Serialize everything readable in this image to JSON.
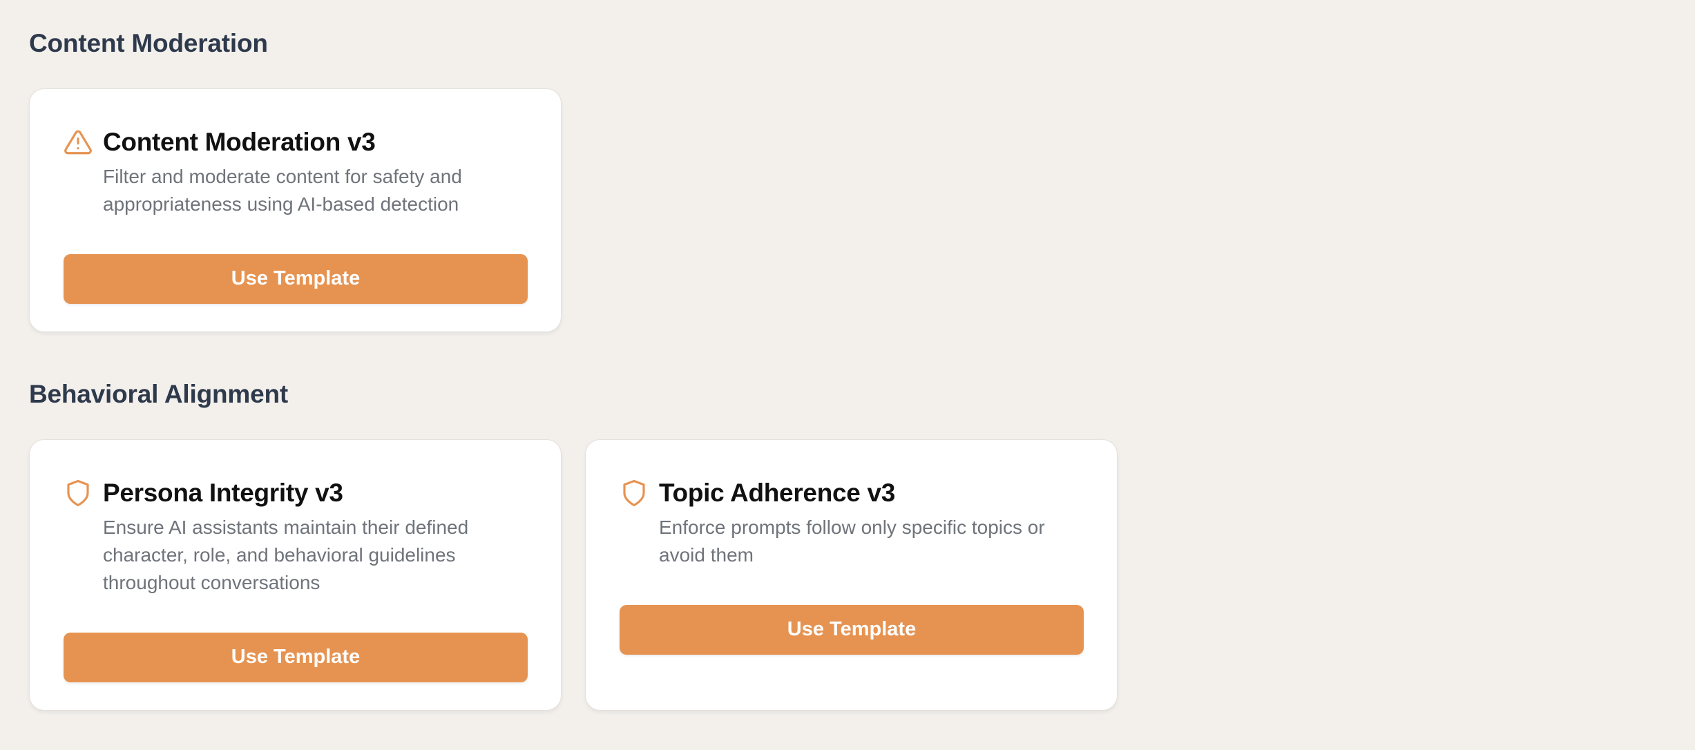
{
  "accent_color": "#e69351",
  "sections": [
    {
      "title": "Content Moderation",
      "cards": [
        {
          "icon": "warning-triangle-icon",
          "title": "Content Moderation v3",
          "description": "Filter and moderate content for safety and appropriateness using AI-based detection",
          "button_label": "Use Template"
        }
      ]
    },
    {
      "title": "Behavioral Alignment",
      "cards": [
        {
          "icon": "shield-icon",
          "title": "Persona Integrity v3",
          "description": "Ensure AI assistants maintain their defined character, role, and behavioral guidelines throughout conversations",
          "button_label": "Use Template"
        },
        {
          "icon": "shield-icon",
          "title": "Topic Adherence v3",
          "description": "Enforce prompts follow only specific topics or avoid them",
          "button_label": "Use Template"
        }
      ]
    }
  ]
}
